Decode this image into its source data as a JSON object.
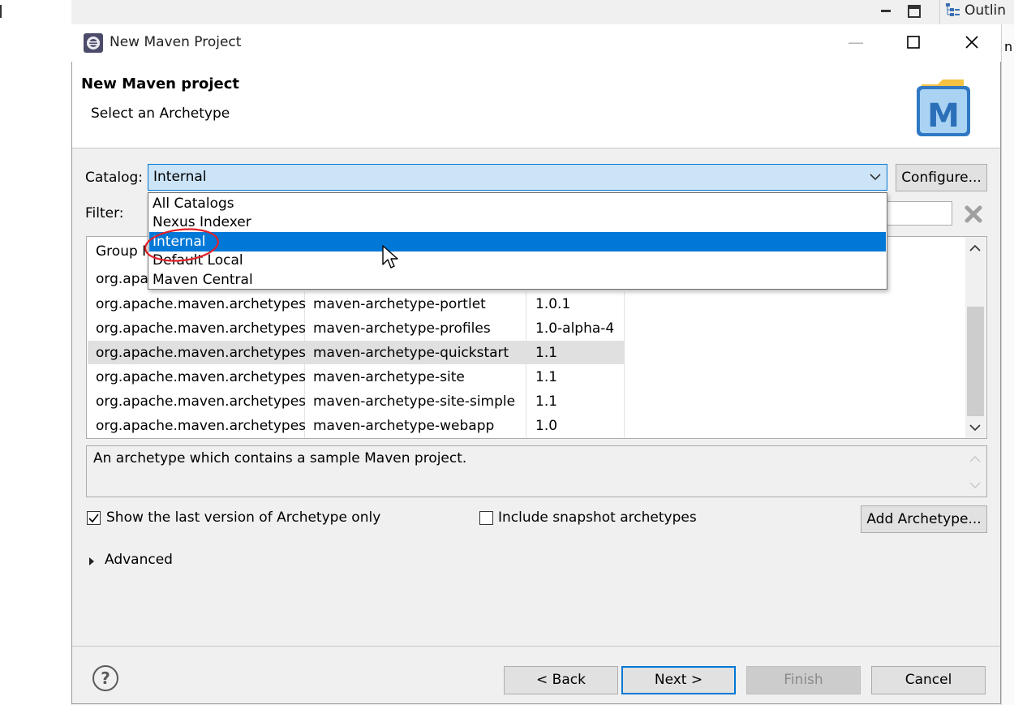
{
  "ide": {
    "outline_tab": "Outlin",
    "right_fragment": "n"
  },
  "dialog": {
    "title": "New Maven Project",
    "header_title": "New Maven project",
    "header_subtitle": "Select an Archetype",
    "logo_letter": "M"
  },
  "catalog": {
    "label": "Catalog:",
    "selected": "Internal",
    "configure_label": "Configure..."
  },
  "dropdown": {
    "options": [
      "All Catalogs",
      "Nexus Indexer",
      "Internal",
      "Default Local",
      "Maven Central"
    ],
    "highlighted_index": 2
  },
  "filter": {
    "label": "Filter:"
  },
  "table": {
    "header_fragment": "Group I",
    "partial_row_fragment": "org.apa",
    "rows": [
      {
        "group": "org.apache.maven.archetypes",
        "artifact": "maven-archetype-portlet",
        "version": "1.0.1"
      },
      {
        "group": "org.apache.maven.archetypes",
        "artifact": "maven-archetype-profiles",
        "version": "1.0-alpha-4"
      },
      {
        "group": "org.apache.maven.archetypes",
        "artifact": "maven-archetype-quickstart",
        "version": "1.1"
      },
      {
        "group": "org.apache.maven.archetypes",
        "artifact": "maven-archetype-site",
        "version": "1.1"
      },
      {
        "group": "org.apache.maven.archetypes",
        "artifact": "maven-archetype-site-simple",
        "version": "1.1"
      },
      {
        "group": "org.apache.maven.archetypes",
        "artifact": "maven-archetype-webapp",
        "version": "1.0"
      }
    ]
  },
  "description": "An archetype which contains a sample Maven project.",
  "options": {
    "show_last_version": "Show the last version of Archetype only",
    "include_snapshot": "Include snapshot archetypes",
    "add_archetype": "Add Archetype..."
  },
  "advanced": {
    "label": "Advanced"
  },
  "buttons": {
    "help": "?",
    "back": "< Back",
    "next": "Next >",
    "finish": "Finish",
    "cancel": "Cancel"
  },
  "colors": {
    "accent": "#0078d7",
    "annotation": "#e0202a"
  }
}
